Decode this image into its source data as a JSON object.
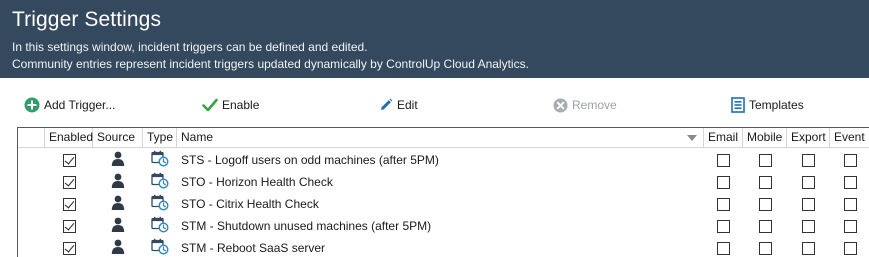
{
  "header": {
    "title": "Trigger Settings",
    "description_line1": "In this settings window, incident triggers can be defined and edited.",
    "description_line2": "Community entries represent incident triggers updated dynamically by ControlUp Cloud Analytics."
  },
  "toolbar": {
    "add_trigger": {
      "label": "Add Trigger...",
      "icon": "add-circle-icon",
      "enabled": true
    },
    "enable": {
      "label": "Enable",
      "icon": "checkmark-icon",
      "enabled": true
    },
    "edit": {
      "label": "Edit",
      "icon": "pencil-icon",
      "enabled": true
    },
    "remove": {
      "label": "Remove",
      "icon": "remove-circle-icon",
      "enabled": false
    },
    "templates": {
      "label": "Templates",
      "icon": "templates-icon",
      "enabled": true
    }
  },
  "columns": {
    "enabled": "Enabled",
    "source": "Source",
    "type": "Type",
    "name": "Name",
    "email": "Email",
    "mobile": "Mobile",
    "export": "Export",
    "event": "Event"
  },
  "rows": [
    {
      "enabled": true,
      "source": "user-icon",
      "type": "scheduled-trigger-icon",
      "name": "STS - Logoff users on odd machines (after 5PM)",
      "email": false,
      "mobile": false,
      "export": false,
      "event": false
    },
    {
      "enabled": true,
      "source": "user-icon",
      "type": "scheduled-trigger-icon",
      "name": "STO - Horizon Health Check",
      "email": false,
      "mobile": false,
      "export": false,
      "event": false
    },
    {
      "enabled": true,
      "source": "user-icon",
      "type": "scheduled-trigger-icon",
      "name": "STO - Citrix Health Check",
      "email": false,
      "mobile": false,
      "export": false,
      "event": false
    },
    {
      "enabled": true,
      "source": "user-icon",
      "type": "scheduled-trigger-icon",
      "name": "STM - Shutdown unused machines (after 5PM)",
      "email": false,
      "mobile": false,
      "export": false,
      "event": false
    },
    {
      "enabled": true,
      "source": "user-icon",
      "type": "scheduled-trigger-icon",
      "name": "STM - Reboot SaaS server",
      "email": false,
      "mobile": false,
      "export": false,
      "event": false
    }
  ],
  "colors": {
    "header_bg": "#34495e",
    "accent_green": "#2e9e6b",
    "accent_blue": "#1f6fb2"
  }
}
